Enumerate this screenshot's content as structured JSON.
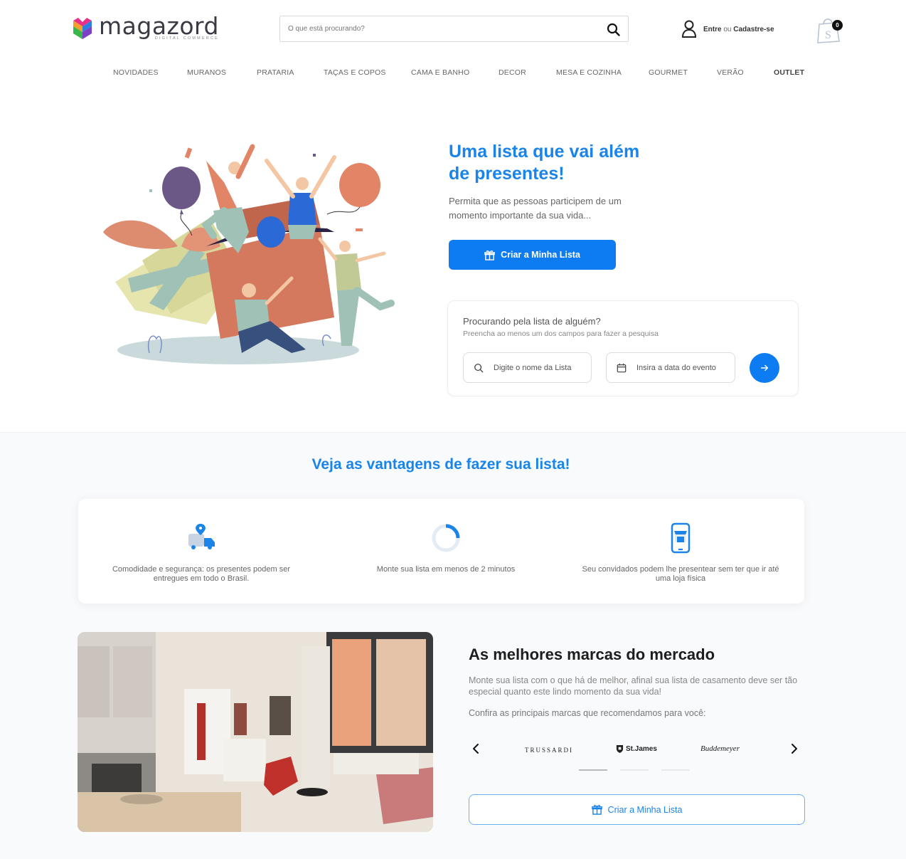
{
  "header": {
    "logo_text": "magazord",
    "logo_subtext": "DIGITAL COMMERCE",
    "search_placeholder": "O que está procurando?",
    "account_login": "Entre",
    "account_or": "ou",
    "account_register": "Cadastre-se",
    "cart_count": "0"
  },
  "nav": {
    "items": [
      "NOVIDADES",
      "MURANOS",
      "PRATARIA",
      "TAÇAS E COPOS",
      "CAMA E BANHO",
      "DECOR",
      "MESA E COZINHA",
      "GOURMET",
      "VERÃO",
      "OUTLET"
    ]
  },
  "hero": {
    "title": "Uma lista que vai além de presentes!",
    "description": "Permita que as pessoas participem de um momento importante da sua vida...",
    "cta_label": "Criar a Minha Lista"
  },
  "find_list": {
    "title": "Procurando pela lista de alguém?",
    "subtitle": "Preencha ao menos um dos campos para fazer a pesquisa",
    "name_placeholder": "Digite o nome da Lista",
    "date_placeholder": "Insira a data do evento"
  },
  "advantages": {
    "title": "Veja as vantagens de fazer sua lista!",
    "items": [
      {
        "text": "Comodidade e segurança: os presentes podem ser entregues em todo o Brasil.",
        "icon": "delivery-truck-icon"
      },
      {
        "text": "Monte sua lista em menos de 2 minutos",
        "icon": "timer-icon"
      },
      {
        "text": "Seu convidados podem lhe presentear sem ter que ir até uma loja física",
        "icon": "mobile-store-icon"
      }
    ]
  },
  "brands": {
    "title": "As melhores marcas do mercado",
    "description": "Monte sua lista com o que há de melhor, afinal sua lista de casamento deve ser tão especial quanto este lindo momento da sua vida!",
    "subtitle": "Confira as principais marcas que recomendamos para você:",
    "items": [
      "TRUSSARDI",
      "St.James",
      "Buddemeyer"
    ],
    "cta_label": "Criar a Minha Lista"
  },
  "colors": {
    "primary": "#0d7cf2",
    "heading_blue": "#1a84e9"
  }
}
